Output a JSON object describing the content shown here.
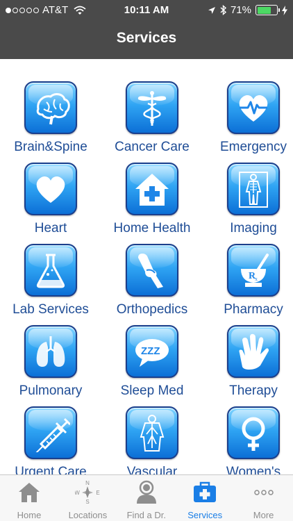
{
  "status_bar": {
    "carrier": "AT&T",
    "time": "10:11 AM",
    "battery": "71%",
    "signal_bars": 1
  },
  "nav": {
    "title": "Services"
  },
  "services": [
    {
      "label": "Brain&Spine",
      "icon": "brain-icon"
    },
    {
      "label": "Cancer Care",
      "icon": "caduceus-icon"
    },
    {
      "label": "Emergency",
      "icon": "heartbeat-icon"
    },
    {
      "label": "Heart",
      "icon": "heart-icon"
    },
    {
      "label": "Home Health",
      "icon": "house-cross-icon"
    },
    {
      "label": "Imaging",
      "icon": "xray-body-icon"
    },
    {
      "label": "Lab Services",
      "icon": "flask-icon"
    },
    {
      "label": "Orthopedics",
      "icon": "knee-joint-icon"
    },
    {
      "label": "Pharmacy",
      "icon": "mortar-rx-icon"
    },
    {
      "label": "Pulmonary",
      "icon": "lungs-icon"
    },
    {
      "label": "Sleep Med",
      "icon": "zzz-bubble-icon"
    },
    {
      "label": "Therapy",
      "icon": "hand-icon"
    },
    {
      "label": "Urgent Care",
      "icon": "syringe-icon"
    },
    {
      "label": "Vascular",
      "icon": "vascular-body-icon"
    },
    {
      "label": "Women's",
      "icon": "female-symbol-icon"
    }
  ],
  "tabs": [
    {
      "label": "Home",
      "icon": "house-icon",
      "active": false
    },
    {
      "label": "Locations",
      "icon": "compass-icon",
      "compass": {
        "n": "N",
        "e": "E",
        "s": "S",
        "w": "W"
      },
      "active": false
    },
    {
      "label": "Find a Dr.",
      "icon": "doctor-icon",
      "active": false
    },
    {
      "label": "Services",
      "icon": "medical-kit-icon",
      "active": true
    },
    {
      "label": "More",
      "icon": "more-dots-icon",
      "active": false
    }
  ],
  "colors": {
    "header": "#4a4a4a",
    "label_text": "#1f4d96",
    "tab_active": "#1a7ee6",
    "tab_inactive": "#8e8e8e",
    "battery": "#4cd964"
  }
}
